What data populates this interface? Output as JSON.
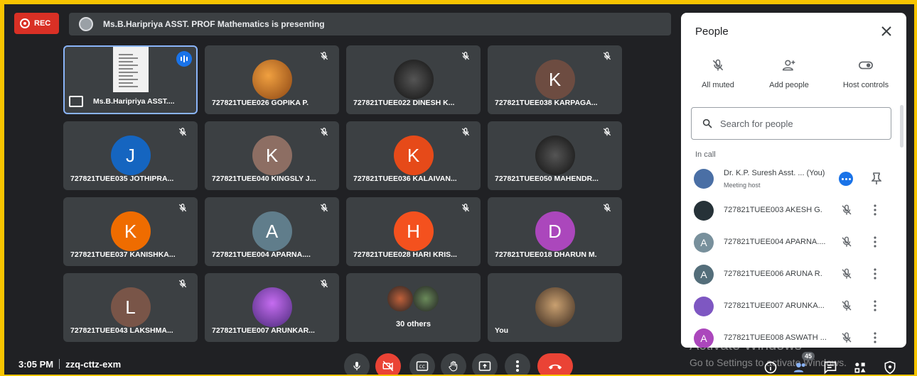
{
  "top": {
    "rec_label": "REC",
    "presenting_text": "Ms.B.Haripriya ASST. PROF Mathematics is presenting"
  },
  "grid": [
    {
      "name": "Ms.B.Haripriya ASST....",
      "kind": "presenter"
    },
    {
      "name": "727821TUEE026 GOPIKA P.",
      "kind": "photo",
      "style": "photo"
    },
    {
      "name": "727821TUEE022 DINESH K...",
      "kind": "photo",
      "style": "photo3"
    },
    {
      "name": "727821TUEE038 KARPAGA...",
      "kind": "letter",
      "letter": "K",
      "color": "#6d4c41"
    },
    {
      "name": "727821TUEE035 JOTHIPRA...",
      "kind": "letter",
      "letter": "J",
      "color": "#1565c0"
    },
    {
      "name": "727821TUEE040 KINGSLY J...",
      "kind": "letter",
      "letter": "K",
      "color": "#8d6e63"
    },
    {
      "name": "727821TUEE036 KALAIVAN...",
      "kind": "letter",
      "letter": "K",
      "color": "#e64a19"
    },
    {
      "name": "727821TUEE050 MAHENDR...",
      "kind": "photo",
      "style": "photo3"
    },
    {
      "name": "727821TUEE037 KANISHKA...",
      "kind": "letter",
      "letter": "K",
      "color": "#ef6c00"
    },
    {
      "name": "727821TUEE004 APARNA....",
      "kind": "letter",
      "letter": "A",
      "color": "#607d8b"
    },
    {
      "name": "727821TUEE028 HARI KRIS...",
      "kind": "letter",
      "letter": "H",
      "color": "#f4511e"
    },
    {
      "name": "727821TUEE018 DHARUN M.",
      "kind": "letter",
      "letter": "D",
      "color": "#ab47bc"
    },
    {
      "name": "727821TUEE043 LAKSHMA...",
      "kind": "letter",
      "letter": "L",
      "color": "#795548"
    },
    {
      "name": "727821TUEE007 ARUNKAR...",
      "kind": "photo",
      "style": "photo4"
    },
    {
      "name": "30 others",
      "kind": "others"
    },
    {
      "name": "You",
      "kind": "photo",
      "style": "photo2"
    }
  ],
  "bottom": {
    "time": "3:05 PM",
    "meeting_code": "zzq-cttz-exm",
    "participants_badge": "45",
    "watermark_title": "Activate Windows",
    "watermark_sub": "Go to Settings to activate Windows."
  },
  "panel": {
    "title": "People",
    "controls": [
      {
        "label": "All muted",
        "icon": "mic-off-icon"
      },
      {
        "label": "Add people",
        "icon": "add-person-icon"
      },
      {
        "label": "Host controls",
        "icon": "toggle-icon"
      }
    ],
    "search_placeholder": "Search for people",
    "in_call_label": "In call",
    "participants": [
      {
        "name": "Dr. K.P. Suresh Asst. ...",
        "you": "(You)",
        "sub": "Meeting host",
        "avatar": "",
        "color": "#4a6fa5"
      },
      {
        "name": "727821TUEE003 AKESH G.",
        "avatar": "",
        "color": "#263238"
      },
      {
        "name": "727821TUEE004 APARNA....",
        "avatar": "A",
        "color": "#78909c"
      },
      {
        "name": "727821TUEE006 ARUNA R.",
        "avatar": "A",
        "color": "#546e7a"
      },
      {
        "name": "727821TUEE007 ARUNKA...",
        "avatar": "",
        "color": "#7e57c2"
      },
      {
        "name": "727821TUEE008 ASWATH ...",
        "avatar": "A",
        "color": "#ab47bc"
      }
    ]
  }
}
